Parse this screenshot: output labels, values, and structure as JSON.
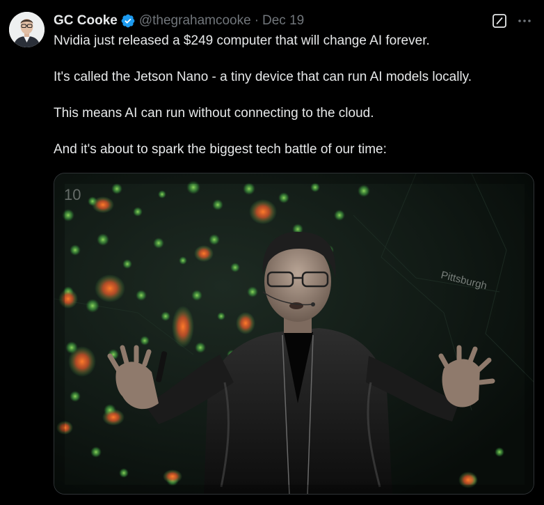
{
  "author": {
    "display_name": "GC Cooke",
    "handle": "@thegrahamcooke",
    "separator": "·",
    "date": "Dec 19",
    "verified": true
  },
  "tweet": {
    "paragraphs": [
      "Nvidia just released a $249 computer that will change AI forever.",
      "It's called the Jetson Nano - a tiny device that can run AI models locally.",
      "This means AI can run without connecting to the cloud.",
      "And it's about to spark the biggest tech battle of our time:"
    ]
  },
  "media": {
    "background_label_left": "10",
    "background_label_right": "Pittsburgh"
  },
  "icons": {
    "verified": "verified-badge-icon",
    "grok": "grok-icon",
    "more": "more-options-icon"
  },
  "colors": {
    "background": "#000000",
    "text_primary": "#e7e9ea",
    "text_secondary": "#71767b",
    "verified_blue": "#1d9bf0",
    "media_border": "#2f3336"
  }
}
